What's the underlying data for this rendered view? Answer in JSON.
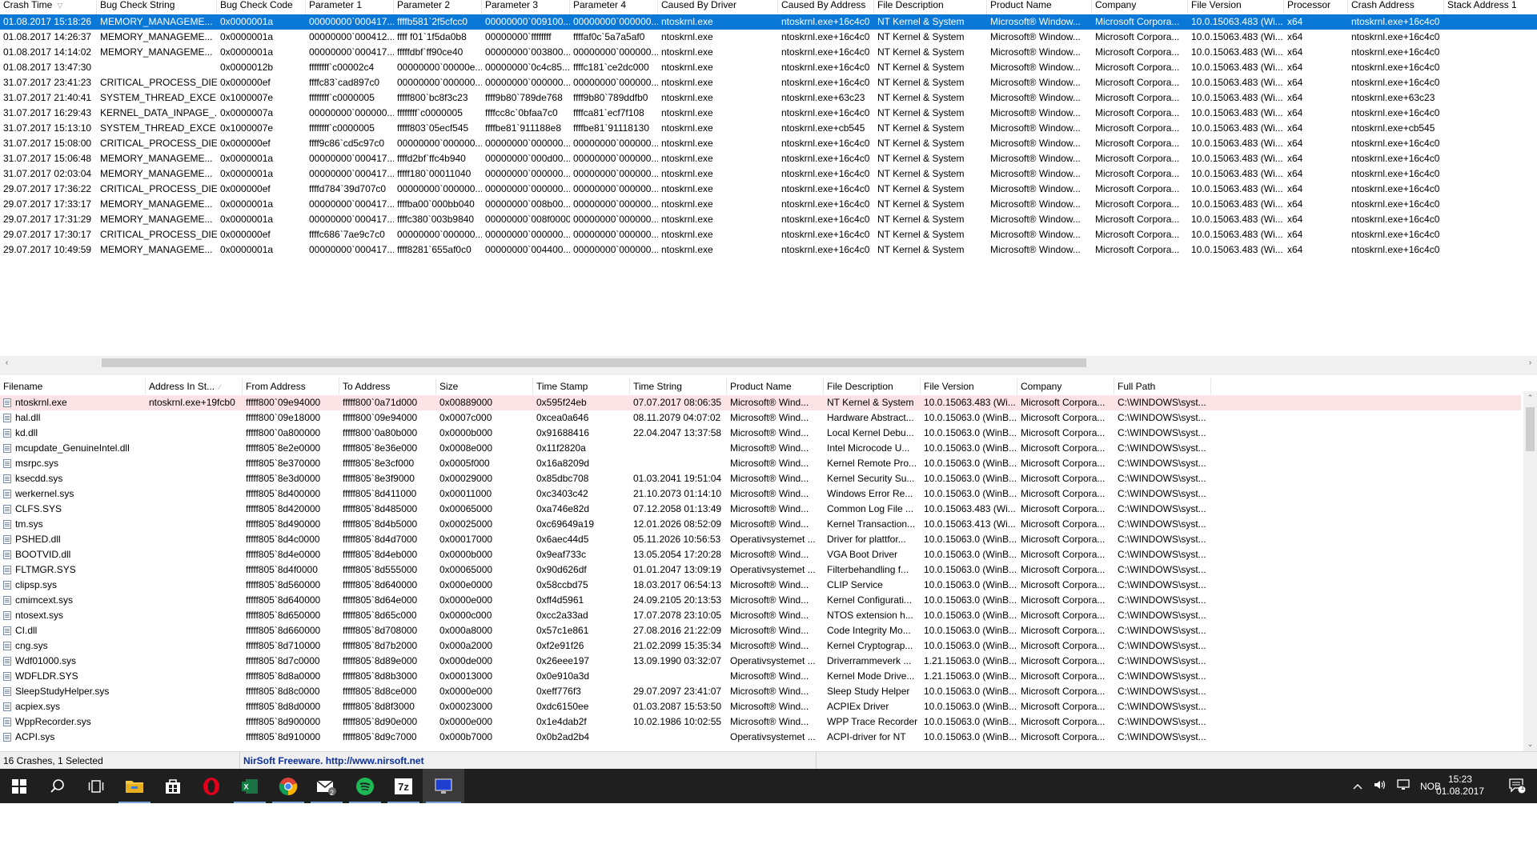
{
  "upper_table": {
    "columns": [
      "Crash Time",
      "Bug Check String",
      "Bug Check Code",
      "Parameter 1",
      "Parameter 2",
      "Parameter 3",
      "Parameter 4",
      "Caused By Driver",
      "Caused By Address",
      "File Description",
      "Product Name",
      "Company",
      "File Version",
      "Processor",
      "Crash Address",
      "Stack Address 1"
    ],
    "rows": [
      [
        "01.08.2017 15:18:26",
        "MEMORY_MANAGEME...",
        "0x0000001a",
        "00000000`000417...",
        "ffffb581`2f5cfcc0",
        "00000000`009100...",
        "00000000`000000...",
        "ntoskrnl.exe",
        "ntoskrnl.exe+16c4c0",
        "NT Kernel & System",
        "Microsoft® Window...",
        "Microsoft Corpora...",
        "10.0.15063.483 (Wi...",
        "x64",
        "ntoskrnl.exe+16c4c0",
        ""
      ],
      [
        "01.08.2017 14:26:37",
        "MEMORY_MANAGEME...",
        "0x0000001a",
        "00000000`000412...",
        "ffff f01`1f5da0b8",
        "00000000`ffffffff",
        "ffffaf0c`5a7a5af0",
        "ntoskrnl.exe",
        "ntoskrnl.exe+16c4c0",
        "NT Kernel & System",
        "Microsoft® Window...",
        "Microsoft Corpora...",
        "10.0.15063.483 (Wi...",
        "x64",
        "ntoskrnl.exe+16c4c0",
        ""
      ],
      [
        "01.08.2017 14:14:02",
        "MEMORY_MANAGEME...",
        "0x0000001a",
        "00000000`000417...",
        "fffffdbf`ff90ce40",
        "00000000`003800...",
        "00000000`000000...",
        "ntoskrnl.exe",
        "ntoskrnl.exe+16c4c0",
        "NT Kernel & System",
        "Microsoft® Window...",
        "Microsoft Corpora...",
        "10.0.15063.483 (Wi...",
        "x64",
        "ntoskrnl.exe+16c4c0",
        ""
      ],
      [
        "01.08.2017 13:47:30",
        "",
        "0x0000012b",
        "ffffffff`c00002c4",
        "00000000`00000e...",
        "00000000`0c4c85...",
        "ffffc181`ce2dc000",
        "ntoskrnl.exe",
        "ntoskrnl.exe+16c4c0",
        "NT Kernel & System",
        "Microsoft® Window...",
        "Microsoft Corpora...",
        "10.0.15063.483 (Wi...",
        "x64",
        "ntoskrnl.exe+16c4c0",
        ""
      ],
      [
        "31.07.2017 23:41:23",
        "CRITICAL_PROCESS_DIED",
        "0x000000ef",
        "ffffc83`cad897c0",
        "00000000`000000...",
        "00000000`000000...",
        "00000000`000000...",
        "ntoskrnl.exe",
        "ntoskrnl.exe+16c4c0",
        "NT Kernel & System",
        "Microsoft® Window...",
        "Microsoft Corpora...",
        "10.0.15063.483 (Wi...",
        "x64",
        "ntoskrnl.exe+16c4c0",
        ""
      ],
      [
        "31.07.2017 21:40:41",
        "SYSTEM_THREAD_EXCE...",
        "0x1000007e",
        "ffffffff`c0000005",
        "fffff800`bc8f3c23",
        "ffff9b80`789de768",
        "ffff9b80`789ddfb0",
        "ntoskrnl.exe",
        "ntoskrnl.exe+63c23",
        "NT Kernel & System",
        "Microsoft® Window...",
        "Microsoft Corpora...",
        "10.0.15063.483 (Wi...",
        "x64",
        "ntoskrnl.exe+63c23",
        ""
      ],
      [
        "31.07.2017 16:29:43",
        "KERNEL_DATA_INPAGE_...",
        "0x0000007a",
        "00000000`000000...",
        "ffffffff`c0000005",
        "ffffcc8c`0bfaa7c0",
        "ffffca81`ecf7f108",
        "ntoskrnl.exe",
        "ntoskrnl.exe+16c4c0",
        "NT Kernel & System",
        "Microsoft® Window...",
        "Microsoft Corpora...",
        "10.0.15063.483 (Wi...",
        "x64",
        "ntoskrnl.exe+16c4c0",
        ""
      ],
      [
        "31.07.2017 15:13:10",
        "SYSTEM_THREAD_EXCE...",
        "0x1000007e",
        "ffffffff`c0000005",
        "fffff803`05ecf545",
        "ffffbe81`911188e8",
        "ffffbe81`91118130",
        "ntoskrnl.exe",
        "ntoskrnl.exe+cb545",
        "NT Kernel & System",
        "Microsoft® Window...",
        "Microsoft Corpora...",
        "10.0.15063.483 (Wi...",
        "x64",
        "ntoskrnl.exe+cb545",
        ""
      ],
      [
        "31.07.2017 15:08:00",
        "CRITICAL_PROCESS_DIED",
        "0x000000ef",
        "ffff9c86`cd5c97c0",
        "00000000`000000...",
        "00000000`000000...",
        "00000000`000000...",
        "ntoskrnl.exe",
        "ntoskrnl.exe+16c4c0",
        "NT Kernel & System",
        "Microsoft® Window...",
        "Microsoft Corpora...",
        "10.0.15063.483 (Wi...",
        "x64",
        "ntoskrnl.exe+16c4c0",
        ""
      ],
      [
        "31.07.2017 15:06:48",
        "MEMORY_MANAGEME...",
        "0x0000001a",
        "00000000`000417...",
        "ffffd2bf`ffc4b940",
        "00000000`000d00...",
        "00000000`000000...",
        "ntoskrnl.exe",
        "ntoskrnl.exe+16c4c0",
        "NT Kernel & System",
        "Microsoft® Window...",
        "Microsoft Corpora...",
        "10.0.15063.483 (Wi...",
        "x64",
        "ntoskrnl.exe+16c4c0",
        ""
      ],
      [
        "31.07.2017 02:03:04",
        "MEMORY_MANAGEME...",
        "0x0000001a",
        "00000000`000417...",
        "fffff180`00011040",
        "00000000`000000...",
        "00000000`000000...",
        "ntoskrnl.exe",
        "ntoskrnl.exe+16c4c0",
        "NT Kernel & System",
        "Microsoft® Window...",
        "Microsoft Corpora...",
        "10.0.15063.483 (Wi...",
        "x64",
        "ntoskrnl.exe+16c4c0",
        ""
      ],
      [
        "29.07.2017 17:36:22",
        "CRITICAL_PROCESS_DIED",
        "0x000000ef",
        "ffffd784`39d707c0",
        "00000000`000000...",
        "00000000`000000...",
        "00000000`000000...",
        "ntoskrnl.exe",
        "ntoskrnl.exe+16c4c0",
        "NT Kernel & System",
        "Microsoft® Window...",
        "Microsoft Corpora...",
        "10.0.15063.483 (Wi...",
        "x64",
        "ntoskrnl.exe+16c4c0",
        ""
      ],
      [
        "29.07.2017 17:33:17",
        "MEMORY_MANAGEME...",
        "0x0000001a",
        "00000000`000417...",
        "ffffba00`000bb040",
        "00000000`008b00...",
        "00000000`000000...",
        "ntoskrnl.exe",
        "ntoskrnl.exe+16c4c0",
        "NT Kernel & System",
        "Microsoft® Window...",
        "Microsoft Corpora...",
        "10.0.15063.483 (Wi...",
        "x64",
        "ntoskrnl.exe+16c4c0",
        ""
      ],
      [
        "29.07.2017 17:31:29",
        "MEMORY_MANAGEME...",
        "0x0000001a",
        "00000000`000417...",
        "ffffc380`003b9840",
        "00000000`008f0000",
        "00000000`000000...",
        "ntoskrnl.exe",
        "ntoskrnl.exe+16c4c0",
        "NT Kernel & System",
        "Microsoft® Window...",
        "Microsoft Corpora...",
        "10.0.15063.483 (Wi...",
        "x64",
        "ntoskrnl.exe+16c4c0",
        ""
      ],
      [
        "29.07.2017 17:30:17",
        "CRITICAL_PROCESS_DIED",
        "0x000000ef",
        "ffffc686`7ae9c7c0",
        "00000000`000000...",
        "00000000`000000...",
        "00000000`000000...",
        "ntoskrnl.exe",
        "ntoskrnl.exe+16c4c0",
        "NT Kernel & System",
        "Microsoft® Window...",
        "Microsoft Corpora...",
        "10.0.15063.483 (Wi...",
        "x64",
        "ntoskrnl.exe+16c4c0",
        ""
      ],
      [
        "29.07.2017 10:49:59",
        "MEMORY_MANAGEME...",
        "0x0000001a",
        "00000000`000417...",
        "ffff8281`655af0c0",
        "00000000`004400...",
        "00000000`000000...",
        "ntoskrnl.exe",
        "ntoskrnl.exe+16c4c0",
        "NT Kernel & System",
        "Microsoft® Window...",
        "Microsoft Corpora...",
        "10.0.15063.483 (Wi...",
        "x64",
        "ntoskrnl.exe+16c4c0",
        ""
      ]
    ]
  },
  "lower_table": {
    "columns": [
      "Filename",
      "Address In St...",
      "From Address",
      "To Address",
      "Size",
      "Time Stamp",
      "Time String",
      "Product Name",
      "File Description",
      "File Version",
      "Company",
      "Full Path"
    ],
    "rows": [
      [
        "ntoskrnl.exe",
        "ntoskrnl.exe+19fcb0",
        "fffff800`09e94000",
        "fffff800`0a71d000",
        "0x00889000",
        "0x595f24eb",
        "07.07.2017 08:06:35",
        "Microsoft® Wind...",
        "NT Kernel & System",
        "10.0.15063.483 (Wi...",
        "Microsoft Corpora...",
        "C:\\WINDOWS\\syst..."
      ],
      [
        "hal.dll",
        "",
        "fffff800`09e18000",
        "fffff800`09e94000",
        "0x0007c000",
        "0xcea0a646",
        "08.11.2079 04:07:02",
        "Microsoft® Wind...",
        "Hardware Abstract...",
        "10.0.15063.0 (WinB...",
        "Microsoft Corpora...",
        "C:\\WINDOWS\\syst..."
      ],
      [
        "kd.dll",
        "",
        "fffff800`0a800000",
        "fffff800`0a80b000",
        "0x0000b000",
        "0x91688416",
        "22.04.2047 13:37:58",
        "Microsoft® Wind...",
        "Local Kernel Debu...",
        "10.0.15063.0 (WinB...",
        "Microsoft Corpora...",
        "C:\\WINDOWS\\syst..."
      ],
      [
        "mcupdate_GenuineIntel.dll",
        "",
        "fffff805`8e2e0000",
        "fffff805`8e36e000",
        "0x0008e000",
        "0x11f2820a",
        "",
        "Microsoft® Wind...",
        "Intel Microcode U...",
        "10.0.15063.0 (WinB...",
        "Microsoft Corpora...",
        "C:\\WINDOWS\\syst..."
      ],
      [
        "msrpc.sys",
        "",
        "fffff805`8e370000",
        "fffff805`8e3cf000",
        "0x0005f000",
        "0x16a8209d",
        "",
        "Microsoft® Wind...",
        "Kernel Remote Pro...",
        "10.0.15063.0 (WinB...",
        "Microsoft Corpora...",
        "C:\\WINDOWS\\syst..."
      ],
      [
        "ksecdd.sys",
        "",
        "fffff805`8e3d0000",
        "fffff805`8e3f9000",
        "0x00029000",
        "0x85dbc708",
        "01.03.2041 19:51:04",
        "Microsoft® Wind...",
        "Kernel Security Su...",
        "10.0.15063.0 (WinB...",
        "Microsoft Corpora...",
        "C:\\WINDOWS\\syst..."
      ],
      [
        "werkernel.sys",
        "",
        "fffff805`8d400000",
        "fffff805`8d411000",
        "0x00011000",
        "0xc3403c42",
        "21.10.2073 01:14:10",
        "Microsoft® Wind...",
        "Windows Error Re...",
        "10.0.15063.0 (WinB...",
        "Microsoft Corpora...",
        "C:\\WINDOWS\\syst..."
      ],
      [
        "CLFS.SYS",
        "",
        "fffff805`8d420000",
        "fffff805`8d485000",
        "0x00065000",
        "0xa746e82d",
        "07.12.2058 01:13:49",
        "Microsoft® Wind...",
        "Common Log File ...",
        "10.0.15063.483 (Wi...",
        "Microsoft Corpora...",
        "C:\\WINDOWS\\syst..."
      ],
      [
        "tm.sys",
        "",
        "fffff805`8d490000",
        "fffff805`8d4b5000",
        "0x00025000",
        "0xc69649a19",
        "12.01.2026 08:52:09",
        "Microsoft® Wind...",
        "Kernel Transaction...",
        "10.0.15063.413 (Wi...",
        "Microsoft Corpora...",
        "C:\\WINDOWS\\syst..."
      ],
      [
        "PSHED.dll",
        "",
        "fffff805`8d4c0000",
        "fffff805`8d4d7000",
        "0x00017000",
        "0x6aec44d5",
        "05.11.2026 10:56:53",
        "Operativsystemet ...",
        "Driver for plattfor...",
        "10.0.15063.0 (WinB...",
        "Microsoft Corpora...",
        "C:\\WINDOWS\\syst..."
      ],
      [
        "BOOTVID.dll",
        "",
        "fffff805`8d4e0000",
        "fffff805`8d4eb000",
        "0x0000b000",
        "0x9eaf733c",
        "13.05.2054 17:20:28",
        "Microsoft® Wind...",
        "VGA Boot Driver",
        "10.0.15063.0 (WinB...",
        "Microsoft Corpora...",
        "C:\\WINDOWS\\syst..."
      ],
      [
        "FLTMGR.SYS",
        "",
        "fffff805`8d4f0000",
        "fffff805`8d555000",
        "0x00065000",
        "0x90d626df",
        "01.01.2047 13:09:19",
        "Operativsystemet ...",
        "Filterbehandling f...",
        "10.0.15063.0 (WinB...",
        "Microsoft Corpora...",
        "C:\\WINDOWS\\syst..."
      ],
      [
        "clipsp.sys",
        "",
        "fffff805`8d560000",
        "fffff805`8d640000",
        "0x000e0000",
        "0x58ccbd75",
        "18.03.2017 06:54:13",
        "Microsoft® Wind...",
        "CLIP Service",
        "10.0.15063.0 (WinB...",
        "Microsoft Corpora...",
        "C:\\WINDOWS\\syst..."
      ],
      [
        "cmimcext.sys",
        "",
        "fffff805`8d640000",
        "fffff805`8d64e000",
        "0x0000e000",
        "0xff4d5961",
        "24.09.2105 20:13:53",
        "Microsoft® Wind...",
        "Kernel Configurati...",
        "10.0.15063.0 (WinB...",
        "Microsoft Corpora...",
        "C:\\WINDOWS\\syst..."
      ],
      [
        "ntosext.sys",
        "",
        "fffff805`8d650000",
        "fffff805`8d65c000",
        "0x0000c000",
        "0xcc2a33ad",
        "17.07.2078 23:10:05",
        "Microsoft® Wind...",
        "NTOS extension h...",
        "10.0.15063.0 (WinB...",
        "Microsoft Corpora...",
        "C:\\WINDOWS\\syst..."
      ],
      [
        "CI.dll",
        "",
        "fffff805`8d660000",
        "fffff805`8d708000",
        "0x000a8000",
        "0x57c1e861",
        "27.08.2016 21:22:09",
        "Microsoft® Wind...",
        "Code Integrity Mo...",
        "10.0.15063.0 (WinB...",
        "Microsoft Corpora...",
        "C:\\WINDOWS\\syst..."
      ],
      [
        "cng.sys",
        "",
        "fffff805`8d710000",
        "fffff805`8d7b2000",
        "0x000a2000",
        "0xf2e91f26",
        "21.02.2099 15:35:34",
        "Microsoft® Wind...",
        "Kernel Cryptograp...",
        "10.0.15063.0 (WinB...",
        "Microsoft Corpora...",
        "C:\\WINDOWS\\syst..."
      ],
      [
        "Wdf01000.sys",
        "",
        "fffff805`8d7c0000",
        "fffff805`8d89e000",
        "0x000de000",
        "0x26eee197",
        "13.09.1990 03:32:07",
        "Operativsystemet ...",
        "Driverrammeverk ...",
        "1.21.15063.0 (WinB...",
        "Microsoft Corpora...",
        "C:\\WINDOWS\\syst..."
      ],
      [
        "WDFLDR.SYS",
        "",
        "fffff805`8d8a0000",
        "fffff805`8d8b3000",
        "0x00013000",
        "0x0e910a3d",
        "",
        "Microsoft® Wind...",
        "Kernel Mode Drive...",
        "1.21.15063.0 (WinB...",
        "Microsoft Corpora...",
        "C:\\WINDOWS\\syst..."
      ],
      [
        "SleepStudyHelper.sys",
        "",
        "fffff805`8d8c0000",
        "fffff805`8d8ce000",
        "0x0000e000",
        "0xeff776f3",
        "29.07.2097 23:41:07",
        "Microsoft® Wind...",
        "Sleep Study Helper",
        "10.0.15063.0 (WinB...",
        "Microsoft Corpora...",
        "C:\\WINDOWS\\syst..."
      ],
      [
        "acpiex.sys",
        "",
        "fffff805`8d8d0000",
        "fffff805`8d8f3000",
        "0x00023000",
        "0xdc6150ee",
        "01.03.2087 15:53:50",
        "Microsoft® Wind...",
        "ACPIEx Driver",
        "10.0.15063.0 (WinB...",
        "Microsoft Corpora...",
        "C:\\WINDOWS\\syst..."
      ],
      [
        "WppRecorder.sys",
        "",
        "fffff805`8d900000",
        "fffff805`8d90e000",
        "0x0000e000",
        "0x1e4dab2f",
        "10.02.1986 10:02:55",
        "Microsoft® Wind...",
        "WPP Trace Recorder",
        "10.0.15063.0 (WinB...",
        "Microsoft Corpora...",
        "C:\\WINDOWS\\syst..."
      ],
      [
        "ACPI.sys",
        "",
        "fffff805`8d910000",
        "fffff805`8d9c7000",
        "0x000b7000",
        "0x0b2ad2b4",
        "",
        "Operativsystemet ...",
        "ACPI-driver for NT",
        "10.0.15063.0 (WinB...",
        "Microsoft Corpora...",
        "C:\\WINDOWS\\syst..."
      ]
    ]
  },
  "statusbar": {
    "count": "16 Crashes, 1 Selected",
    "freeware": "NirSoft Freeware.  http://www.nirsoft.net"
  },
  "taskbar": {
    "apps": [
      "start-icon",
      "search-icon",
      "task-view-icon",
      "file-explorer-icon",
      "store-icon",
      "opera-icon",
      "excel-icon",
      "chrome-icon",
      "mail-icon",
      "spotify-icon",
      "7zip-icon",
      "bluescreenview-icon"
    ],
    "mail_badge": "2",
    "language": "NOB",
    "time": "15:23",
    "date": "01.08.2017",
    "notification_badge": "1"
  },
  "colors": {
    "selection": "#0a78d7",
    "highlight_row": "#fbe3e6",
    "taskbar": "#1f1f1f"
  }
}
